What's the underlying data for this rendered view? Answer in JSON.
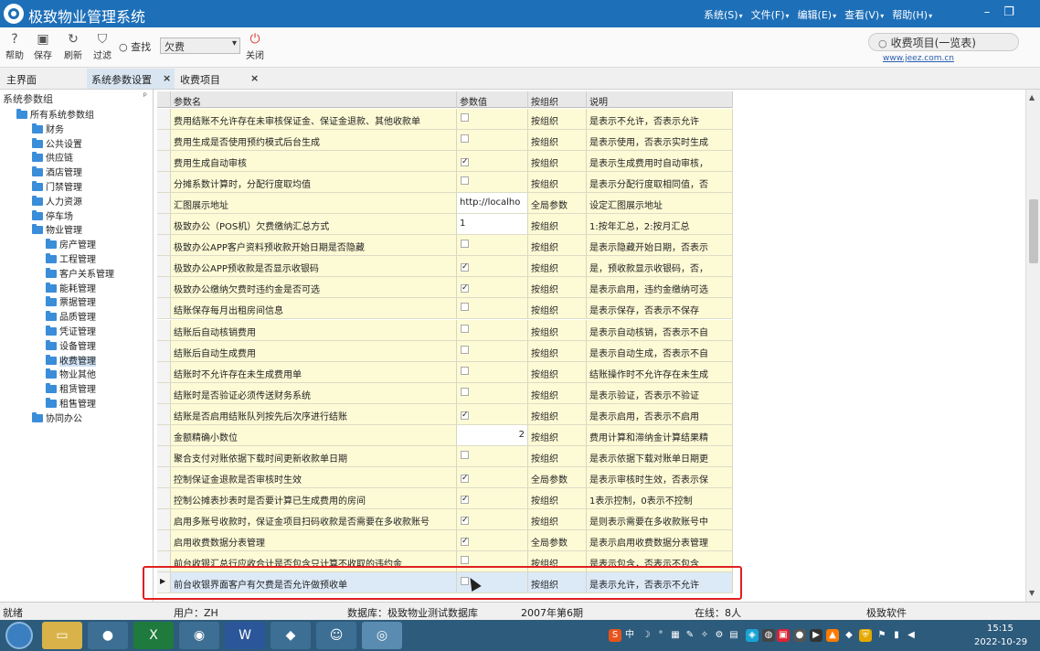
{
  "titlebar": {
    "title": "极致物业管理系统",
    "menu": [
      "系统(S)",
      "文件(F)",
      "编辑(E)",
      "查看(V)",
      "帮助(H)"
    ],
    "minimize": "–",
    "restore": "❐"
  },
  "toolbar": {
    "help": "帮助",
    "save": "保存",
    "refresh": "刷新",
    "filter": "过滤",
    "find_label": "查找",
    "find_value": "欠费",
    "close": "关闭",
    "search_placeholder": "收费项目(一览表)",
    "site_link": "www.jeez.com.cn"
  },
  "tabs": [
    "主界面",
    "系统参数设置",
    "收费项目"
  ],
  "sidebar": {
    "header": "系统参数组",
    "pin": "ᵖ",
    "items": [
      "所有系统参数组",
      "财务",
      "公共设置",
      "供应链",
      "酒店管理",
      "门禁管理",
      "人力资源",
      "停车场",
      "物业管理",
      "房产管理",
      "工程管理",
      "客户关系管理",
      "能耗管理",
      "票据管理",
      "品质管理",
      "凭证管理",
      "设备管理",
      "收费管理",
      "物业其他",
      "租赁管理",
      "租售管理",
      "协同办公"
    ]
  },
  "grid": {
    "headers": [
      "参数名",
      "参数值",
      "按组织",
      "说明"
    ],
    "rows": [
      {
        "name": "费用结账不允许存在未审核保证金、保证金退款、其他收款单",
        "value": "",
        "checked": false,
        "scope": "按组织",
        "desc": "是表示不允许，否表示允许"
      },
      {
        "name": "费用生成是否使用预约模式后台生成",
        "value": "",
        "checked": false,
        "scope": "按组织",
        "desc": "是表示使用，否表示实时生成"
      },
      {
        "name": "费用生成自动审核",
        "value": "",
        "checked": true,
        "scope": "按组织",
        "desc": "是表示生成费用时自动审核，"
      },
      {
        "name": "分摊系数计算时，分配行度取均值",
        "value": "",
        "checked": false,
        "scope": "按组织",
        "desc": "是表示分配行度取相同值，否"
      },
      {
        "name": "汇图展示地址",
        "value": "http://localho",
        "checked": null,
        "scope": "全局参数",
        "desc": "设定汇图展示地址"
      },
      {
        "name": "极致办公（POS机）欠费缴纳汇总方式",
        "value": "1",
        "checked": null,
        "scope": "按组织",
        "desc": "1:按年汇总，2:按月汇总"
      },
      {
        "name": "极致办公APP客户资料预收款开始日期是否隐藏",
        "value": "",
        "checked": false,
        "scope": "按组织",
        "desc": "是表示隐藏开始日期，否表示"
      },
      {
        "name": "极致办公APP预收款是否显示收银码",
        "value": "",
        "checked": true,
        "scope": "按组织",
        "desc": "是，预收款显示收银码，否，"
      },
      {
        "name": "极致办公缴纳欠费时违约金是否可选",
        "value": "",
        "checked": true,
        "scope": "按组织",
        "desc": "是表示启用，违约金缴纳可选"
      },
      {
        "name": "结账保存每月出租房间信息",
        "value": "",
        "checked": false,
        "scope": "按组织",
        "desc": "是表示保存，否表示不保存"
      },
      {
        "name": "结账后自动核销费用",
        "value": "",
        "checked": false,
        "scope": "按组织",
        "desc": "是表示自动核销，否表示不自"
      },
      {
        "name": "结账后自动生成费用",
        "value": "",
        "checked": false,
        "scope": "按组织",
        "desc": "是表示自动生成，否表示不自"
      },
      {
        "name": "结账时不允许存在未生成费用单",
        "value": "",
        "checked": false,
        "scope": "按组织",
        "desc": "结账操作时不允许存在未生成"
      },
      {
        "name": "结账时是否验证必须传送财务系统",
        "value": "",
        "checked": false,
        "scope": "按组织",
        "desc": "是表示验证，否表示不验证"
      },
      {
        "name": "结账是否启用结账队列按先后次序进行结账",
        "value": "",
        "checked": true,
        "scope": "按组织",
        "desc": "是表示启用，否表示不启用"
      },
      {
        "name": "金额精确小数位",
        "value": "2",
        "checked": null,
        "scope": "按组织",
        "desc": "费用计算和滞纳金计算结果精"
      },
      {
        "name": "聚合支付对账依据下载时间更新收款单日期",
        "value": "",
        "checked": false,
        "scope": "按组织",
        "desc": "是表示依据下载对账单日期更"
      },
      {
        "name": "控制保证金退款是否审核时生效",
        "value": "",
        "checked": true,
        "scope": "全局参数",
        "desc": "是表示审核时生效，否表示保"
      },
      {
        "name": "控制公摊表抄表时是否要计算已生成费用的房间",
        "value": "",
        "checked": true,
        "scope": "按组织",
        "desc": "1表示控制，0表示不控制"
      },
      {
        "name": "启用多账号收款时，保证金项目扫码收款是否需要在多收款账号",
        "value": "",
        "checked": true,
        "scope": "按组织",
        "desc": "是则表示需要在多收款账号中"
      },
      {
        "name": "启用收费数据分表管理",
        "value": "",
        "checked": true,
        "scope": "全局参数",
        "desc": "是表示启用收费数据分表管理"
      },
      {
        "name": "前台收银汇总行应收合计是否包含只计算不收取的违约金",
        "value": "",
        "checked": false,
        "scope": "按组织",
        "desc": "是表示包含，否表示不包含"
      },
      {
        "name": "前台收银界面客户有欠费是否允许做预收单",
        "value": "",
        "checked": false,
        "scope": "按组织",
        "desc": "是表示允许，否表示不允许"
      }
    ],
    "current_row_marker": "▶"
  },
  "status": {
    "state": "就绪",
    "user": "用户：ZH",
    "database": "数据库：极致物业测试数据库",
    "period": "2007年第6期",
    "online": "在线：8人",
    "vendor": "极致软件"
  },
  "taskbar": {
    "time": "15:15",
    "date": "2022-10-29",
    "ime": "中"
  }
}
